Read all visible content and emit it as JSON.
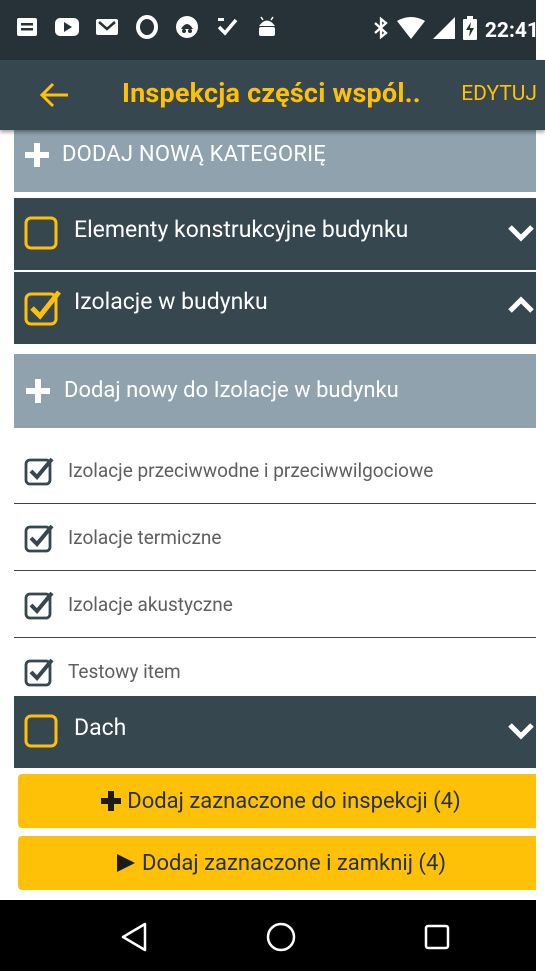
{
  "status_bar": {
    "time": "22:41",
    "icons_left": [
      "notification-icon",
      "youtube-icon",
      "gmail-icon",
      "opera-icon",
      "app-icon",
      "checklist-icon",
      "android-icon"
    ],
    "icons_right": [
      "bluetooth-icon",
      "wifi-icon",
      "signal-icon",
      "battery-charging-icon"
    ]
  },
  "toolbar": {
    "title": "Inspekcja części wspól..",
    "edit_label": "EDYTUJ"
  },
  "add_category": {
    "label": "DODAJ NOWĄ KATEGORIĘ"
  },
  "categories": [
    {
      "label": "Elementy konstrukcyjne budynku",
      "checked": false,
      "expanded": false
    },
    {
      "label": "Izolacje w budynku",
      "checked": true,
      "expanded": true
    },
    {
      "label": "Dach",
      "checked": false,
      "expanded": false
    }
  ],
  "add_item": {
    "label": "Dodaj nowy do Izolacje w budynku"
  },
  "items": [
    {
      "label": "Izolacje przeciwwodne i przeciwwilgociowe",
      "checked": true
    },
    {
      "label": "Izolacje termiczne",
      "checked": true
    },
    {
      "label": "Izolacje akustyczne",
      "checked": true
    },
    {
      "label": "Testowy item",
      "checked": true
    }
  ],
  "buttons": {
    "add_selected": "Dodaj zaznaczone do inspekcji (4)",
    "add_and_close": "Dodaj zaznaczone i zamknij (4)"
  },
  "colors": {
    "accent": "#ffc107",
    "toolbar": "#37474f",
    "status_bar": "#263238",
    "add_row": "#8fa2ae"
  }
}
